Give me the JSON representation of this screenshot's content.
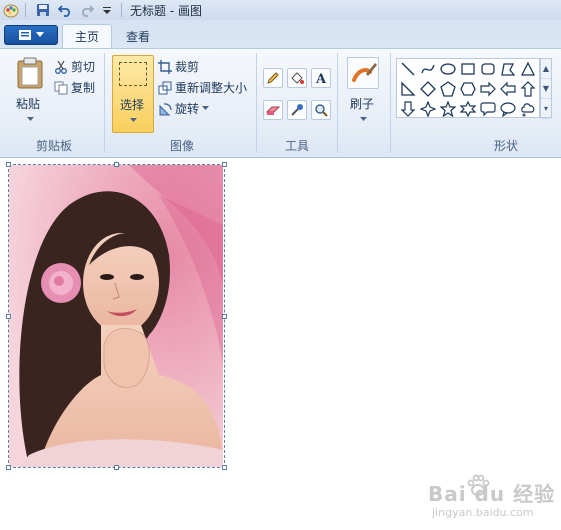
{
  "title_bar": {
    "title": "无标题 - 画图"
  },
  "tabs": [
    {
      "label": "主页",
      "active": true
    },
    {
      "label": "查看",
      "active": false
    }
  ],
  "ribbon": {
    "clipboard": {
      "group_label": "剪贴板",
      "paste_label": "粘贴",
      "cut_label": "剪切",
      "copy_label": "复制"
    },
    "image": {
      "group_label": "图像",
      "select_label": "选择",
      "crop_label": "裁剪",
      "resize_label": "重新调整大小",
      "rotate_label": "旋转"
    },
    "tools": {
      "group_label": "工具",
      "items": [
        "pencil-icon",
        "fill-bucket-icon",
        "text-icon",
        "eraser-icon",
        "color-picker-icon",
        "magnifier-icon"
      ]
    },
    "brushes": {
      "label": "刷子"
    },
    "shapes": {
      "group_label": "形状",
      "items": [
        "line",
        "curve",
        "oval",
        "rectangle",
        "rounded-rectangle",
        "polygon",
        "triangle",
        "right-triangle",
        "diamond",
        "pentagon",
        "hexagon",
        "right-arrow",
        "left-arrow",
        "up-arrow",
        "down-arrow",
        "four-point-star",
        "five-point-star",
        "six-point-star",
        "rounded-callout",
        "oval-callout",
        "cloud-callout"
      ]
    }
  },
  "watermark": {
    "brand": "Bai du 经验",
    "url": "jingyan.baidu.com"
  },
  "colors": {
    "accent": "#f9cf5d",
    "app_button": "#1f5fb0",
    "ribbon_bg": "#e9eff8"
  }
}
